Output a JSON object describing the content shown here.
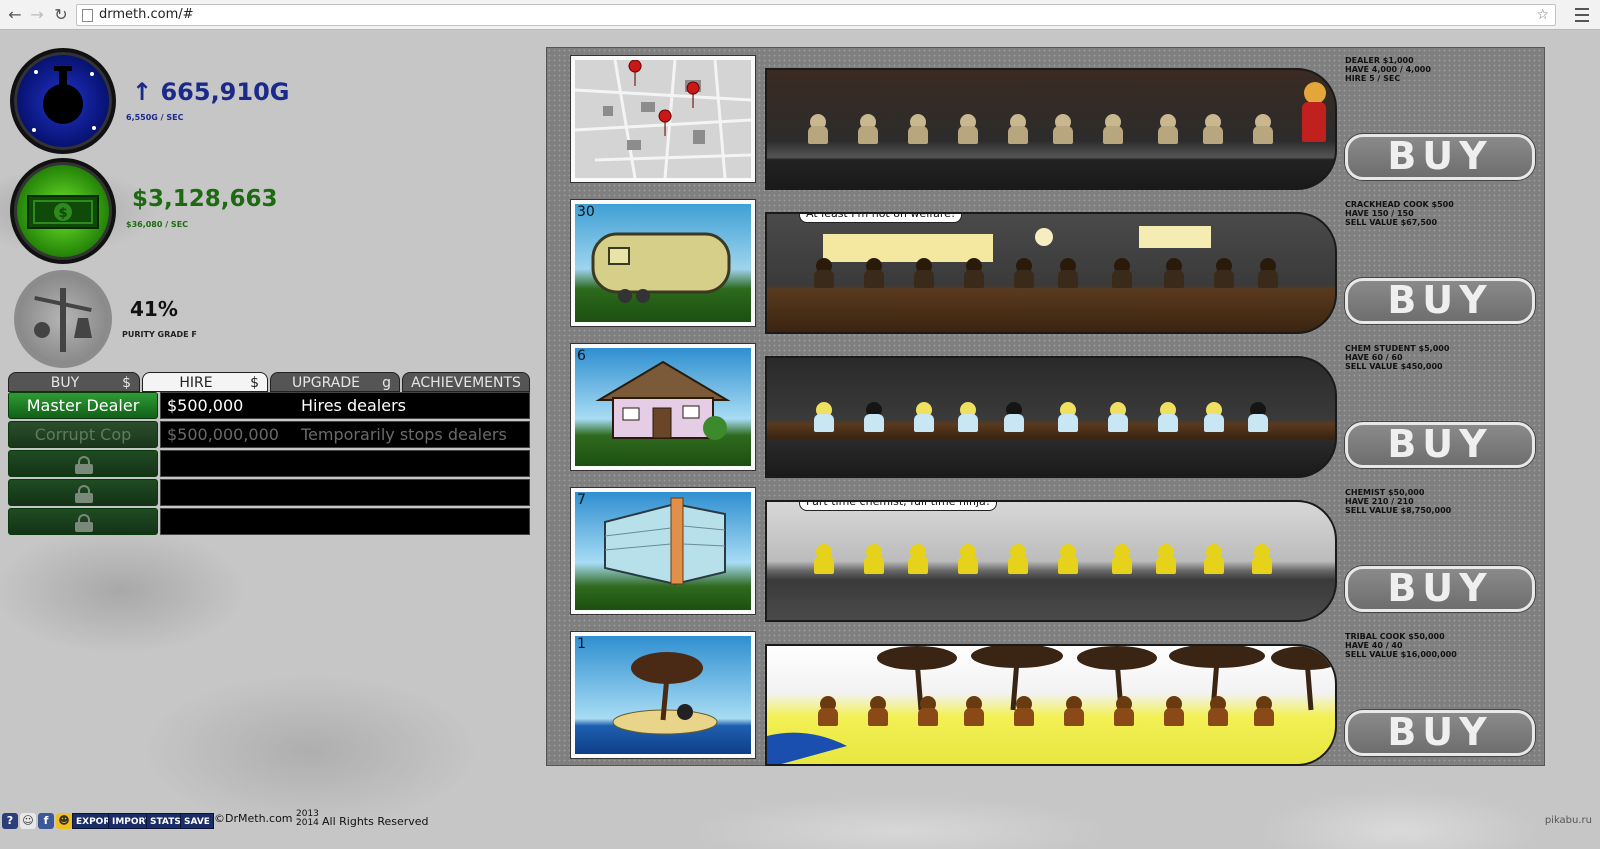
{
  "browser": {
    "url": "drmeth.com/#",
    "back_icon": "arrow-left",
    "forward_icon": "arrow-right",
    "reload_icon": "reload"
  },
  "stats": {
    "meth": {
      "amount": "↑ 665,910G",
      "rate": "6,550G / SEC",
      "icon": "flask-icon"
    },
    "cash": {
      "amount": "$3,128,663",
      "rate": "$36,080 / SEC",
      "icon": "dollar-bill-icon"
    },
    "purity": {
      "amount": "41%",
      "grade": "PURITY GRADE F",
      "icon": "scale-icon"
    }
  },
  "tabs": [
    {
      "label": "BUY",
      "currency": "$"
    },
    {
      "label": "HIRE",
      "currency": "$"
    },
    {
      "label": "UPGRADE",
      "currency": "g"
    },
    {
      "label": "ACHIEVEMENTS",
      "currency": ""
    }
  ],
  "hire_list": [
    {
      "name": "Master Dealer",
      "price": "$500,000",
      "description": "Hires dealers",
      "state": "available"
    },
    {
      "name": "Corrupt Cop",
      "price": "$500,000,000",
      "description": "Temporarily stops dealers",
      "state": "disabled"
    },
    {
      "name": "",
      "price": "",
      "description": "",
      "state": "locked"
    },
    {
      "name": "",
      "price": "",
      "description": "",
      "state": "locked"
    },
    {
      "name": "",
      "price": "",
      "description": "",
      "state": "locked"
    }
  ],
  "businesses": [
    {
      "count": "",
      "thumb": "city-map",
      "line1": "DEALER $1,000",
      "line2": "HAVE 4,000 / 4,000",
      "line3": "HIRE 5 / SEC",
      "buy_label": "BUY",
      "speech": ""
    },
    {
      "count": "30",
      "thumb": "trailer",
      "line1": "CRACKHEAD COOK $500",
      "line2": "HAVE 150 / 150",
      "line3": "SELL VALUE $67,500",
      "buy_label": "BUY",
      "speech": "At least I'm not on welfare!"
    },
    {
      "count": "6",
      "thumb": "house",
      "line1": "CHEM STUDENT $5,000",
      "line2": "HAVE 60 / 60",
      "line3": "SELL VALUE $450,000",
      "buy_label": "BUY",
      "speech": ""
    },
    {
      "count": "7",
      "thumb": "office-building",
      "line1": "CHEMIST $50,000",
      "line2": "HAVE 210 / 210",
      "line3": "SELL VALUE $8,750,000",
      "buy_label": "BUY",
      "speech": "Part time chemist, full time ninja!"
    },
    {
      "count": "1",
      "thumb": "island",
      "line1": "TRIBAL COOK $50,000",
      "line2": "HAVE 40 / 40",
      "line3": "SELL VALUE $16,000,000",
      "buy_label": "BUY",
      "speech": ""
    }
  ],
  "footer": {
    "buttons": [
      "EXPORT",
      "IMPORT",
      "STATS",
      "SAVE"
    ],
    "copyright": "©DrMeth.com -",
    "year_top": "2013",
    "year_bottom": "2014",
    "rights": "All Rights Reserved",
    "watermark": "pikabu.ru"
  },
  "colors": {
    "meth_blue": "#1a2a8a",
    "cash_green": "#1e6a12",
    "panel_gray": "#7f7f7f",
    "hire_button_green": "#2e9c36"
  }
}
